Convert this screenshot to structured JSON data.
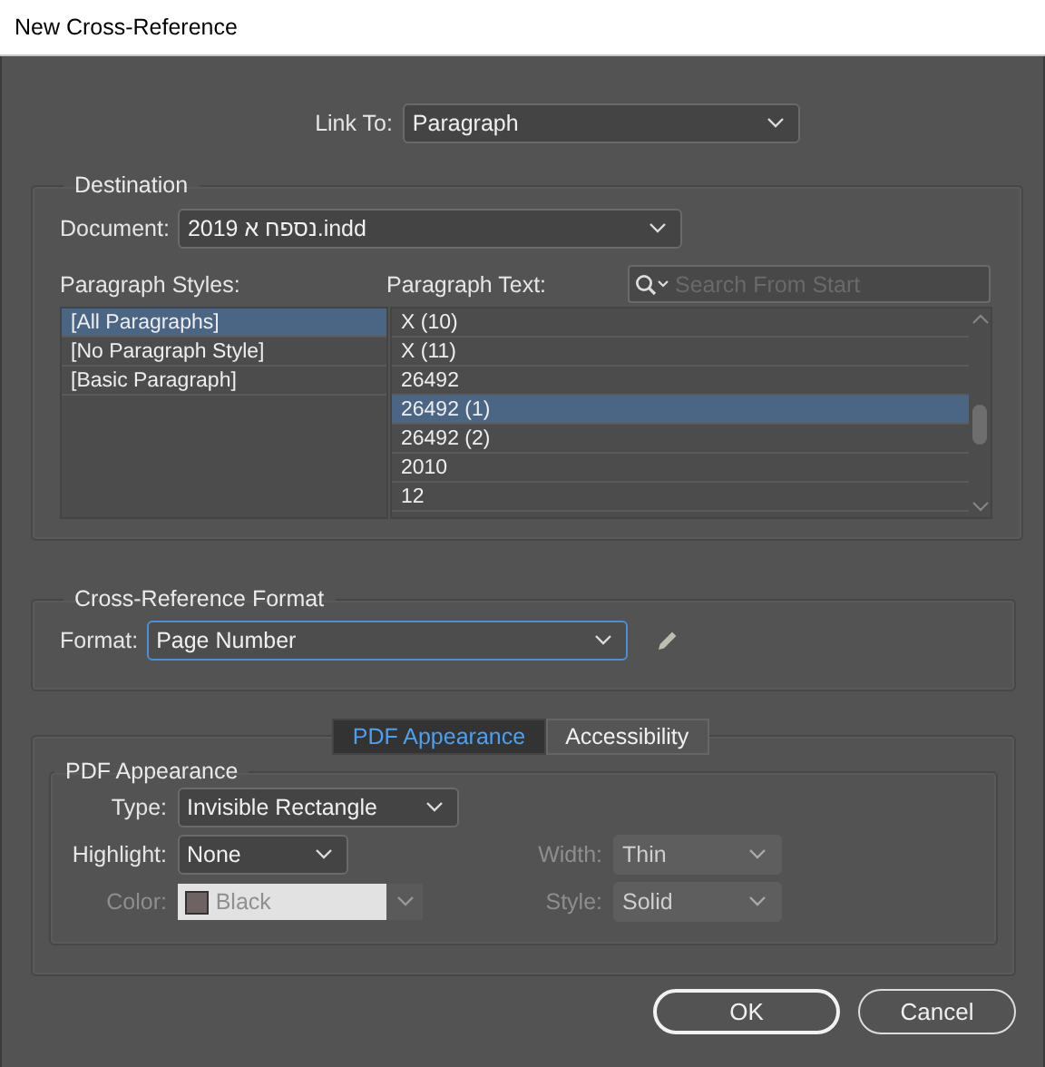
{
  "window": {
    "title": "New Cross-Reference"
  },
  "link_to": {
    "label": "Link To:",
    "value": "Paragraph"
  },
  "destination": {
    "title": "Destination",
    "document": {
      "label": "Document:",
      "value": "נספח א 2019.indd"
    },
    "styles_label": "Paragraph Styles:",
    "text_label": "Paragraph Text:",
    "search": {
      "placeholder": "Search From Start"
    },
    "paragraph_styles": [
      {
        "label": "[All Paragraphs]",
        "selected": true
      },
      {
        "label": "[No Paragraph Style]",
        "selected": false
      },
      {
        "label": "[Basic Paragraph]",
        "selected": false
      }
    ],
    "paragraph_text": [
      {
        "label": "X (10)",
        "selected": false
      },
      {
        "label": "X (11)",
        "selected": false
      },
      {
        "label": "26492",
        "selected": false
      },
      {
        "label": "26492 (1)",
        "selected": true
      },
      {
        "label": "26492 (2)",
        "selected": false
      },
      {
        "label": "2010",
        "selected": false
      },
      {
        "label": "12",
        "selected": false
      }
    ]
  },
  "cross_reference_format": {
    "title": "Cross-Reference Format",
    "format": {
      "label": "Format:",
      "value": "Page Number",
      "focused": true
    }
  },
  "tabs": [
    {
      "label": "PDF Appearance",
      "selected": true
    },
    {
      "label": "Accessibility",
      "selected": false
    }
  ],
  "pdf_appearance": {
    "title": "PDF Appearance",
    "rows": [
      {
        "left": {
          "kind": "select",
          "label": "Type:",
          "value": "Invisible Rectangle",
          "disabled": false
        }
      },
      {
        "left": {
          "kind": "select",
          "label": "Highlight:",
          "value": "None",
          "disabled": false
        },
        "right": {
          "kind": "select",
          "label": "Width:",
          "value": "Thin",
          "disabled": true
        }
      },
      {
        "left": {
          "kind": "color",
          "label": "Color:",
          "value": "Black",
          "disabled": true
        },
        "right": {
          "kind": "select",
          "label": "Style:",
          "value": "Solid",
          "disabled": true
        }
      }
    ]
  },
  "buttons": [
    {
      "label": "OK",
      "default": true
    },
    {
      "label": "Cancel",
      "default": false
    }
  ]
}
